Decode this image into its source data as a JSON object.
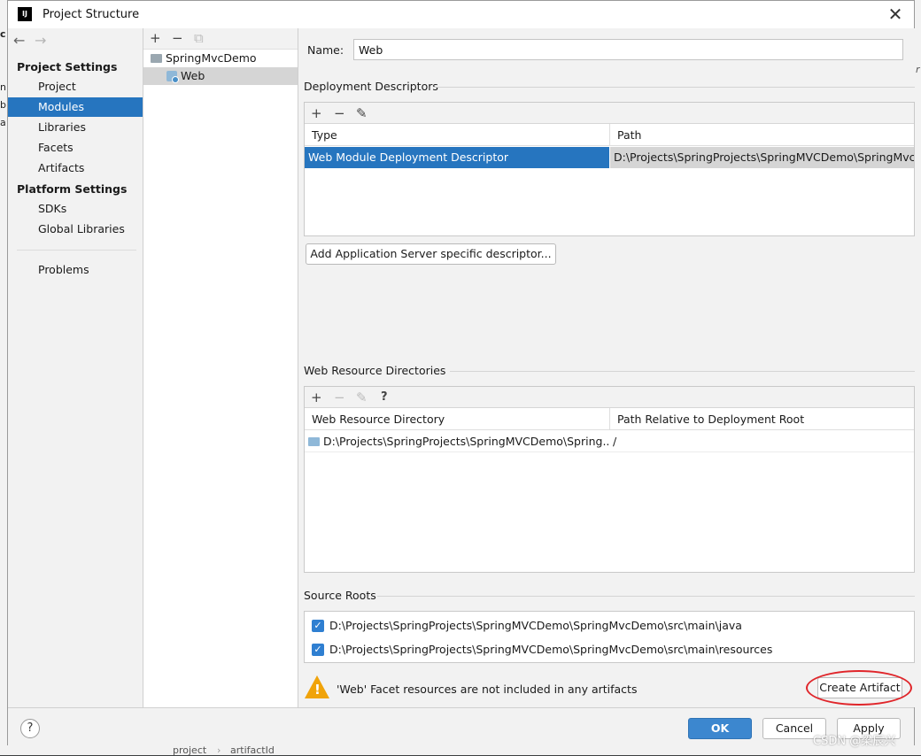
{
  "window": {
    "title": "Project Structure",
    "icon_text": "IJ"
  },
  "background": {
    "left_fragments": [
      "c",
      "nl",
      "b",
      "a"
    ],
    "right_fragment": "r",
    "bottom_breadcrumb": [
      "project",
      "artifactId"
    ]
  },
  "nav": {
    "back_icon": "←",
    "forward_icon": "→",
    "project_settings_header": "Project Settings",
    "project_settings_items": [
      "Project",
      "Modules",
      "Libraries",
      "Facets",
      "Artifacts"
    ],
    "selected_item": "Modules",
    "platform_settings_header": "Platform Settings",
    "platform_settings_items": [
      "SDKs",
      "Global Libraries"
    ],
    "problems_label": "Problems"
  },
  "tree": {
    "toolbar": {
      "add": "+",
      "remove": "−",
      "copy": "⧉"
    },
    "nodes": [
      {
        "label": "SpringMvcDemo",
        "icon": "folder-icon"
      },
      {
        "label": "Web",
        "icon": "web-facet-icon",
        "selected": true
      }
    ]
  },
  "main": {
    "name_label": "Name:",
    "name_value": "Web",
    "deployment_descriptors": {
      "title": "Deployment Descriptors",
      "toolbar": {
        "add": "+",
        "remove": "−",
        "edit": "✎"
      },
      "columns": [
        "Type",
        "Path"
      ],
      "rows": [
        {
          "type": "Web Module Deployment Descriptor",
          "path": "D:\\Projects\\SpringProjects\\SpringMVCDemo\\SpringMvcDemo\\src\\main\\webapp\\WEB-INF\\web.xml"
        }
      ],
      "add_server_descriptor_button": "Add Application Server specific descriptor..."
    },
    "web_resource_directories": {
      "title": "Web Resource Directories",
      "toolbar": {
        "add": "+",
        "remove": "−",
        "edit": "✎",
        "help": "?"
      },
      "columns": [
        "Web Resource Directory",
        "Path Relative to Deployment Root"
      ],
      "rows": [
        {
          "directory": "D:\\Projects\\SpringProjects\\SpringMVCDemo\\Spring...",
          "relative_path": "/"
        }
      ]
    },
    "source_roots": {
      "title": "Source Roots",
      "items": [
        {
          "path": "D:\\Projects\\SpringProjects\\SpringMVCDemo\\SpringMvcDemo\\src\\main\\java",
          "checked": true
        },
        {
          "path": "D:\\Projects\\SpringProjects\\SpringMVCDemo\\SpringMvcDemo\\src\\main\\resources",
          "checked": true
        }
      ]
    },
    "warning": {
      "text": "'Web' Facet resources are not included in any artifacts",
      "create_artifact_button": "Create Artifact"
    }
  },
  "footer": {
    "help": "?",
    "ok": "OK",
    "cancel": "Cancel",
    "apply": "Apply"
  },
  "watermark": "CSDN @梁辰兴",
  "colors": {
    "selection_blue": "#2675bf",
    "primary_button": "#3c87cf",
    "warning_orange": "#f0a30a",
    "annotation_red": "#e0252a"
  }
}
